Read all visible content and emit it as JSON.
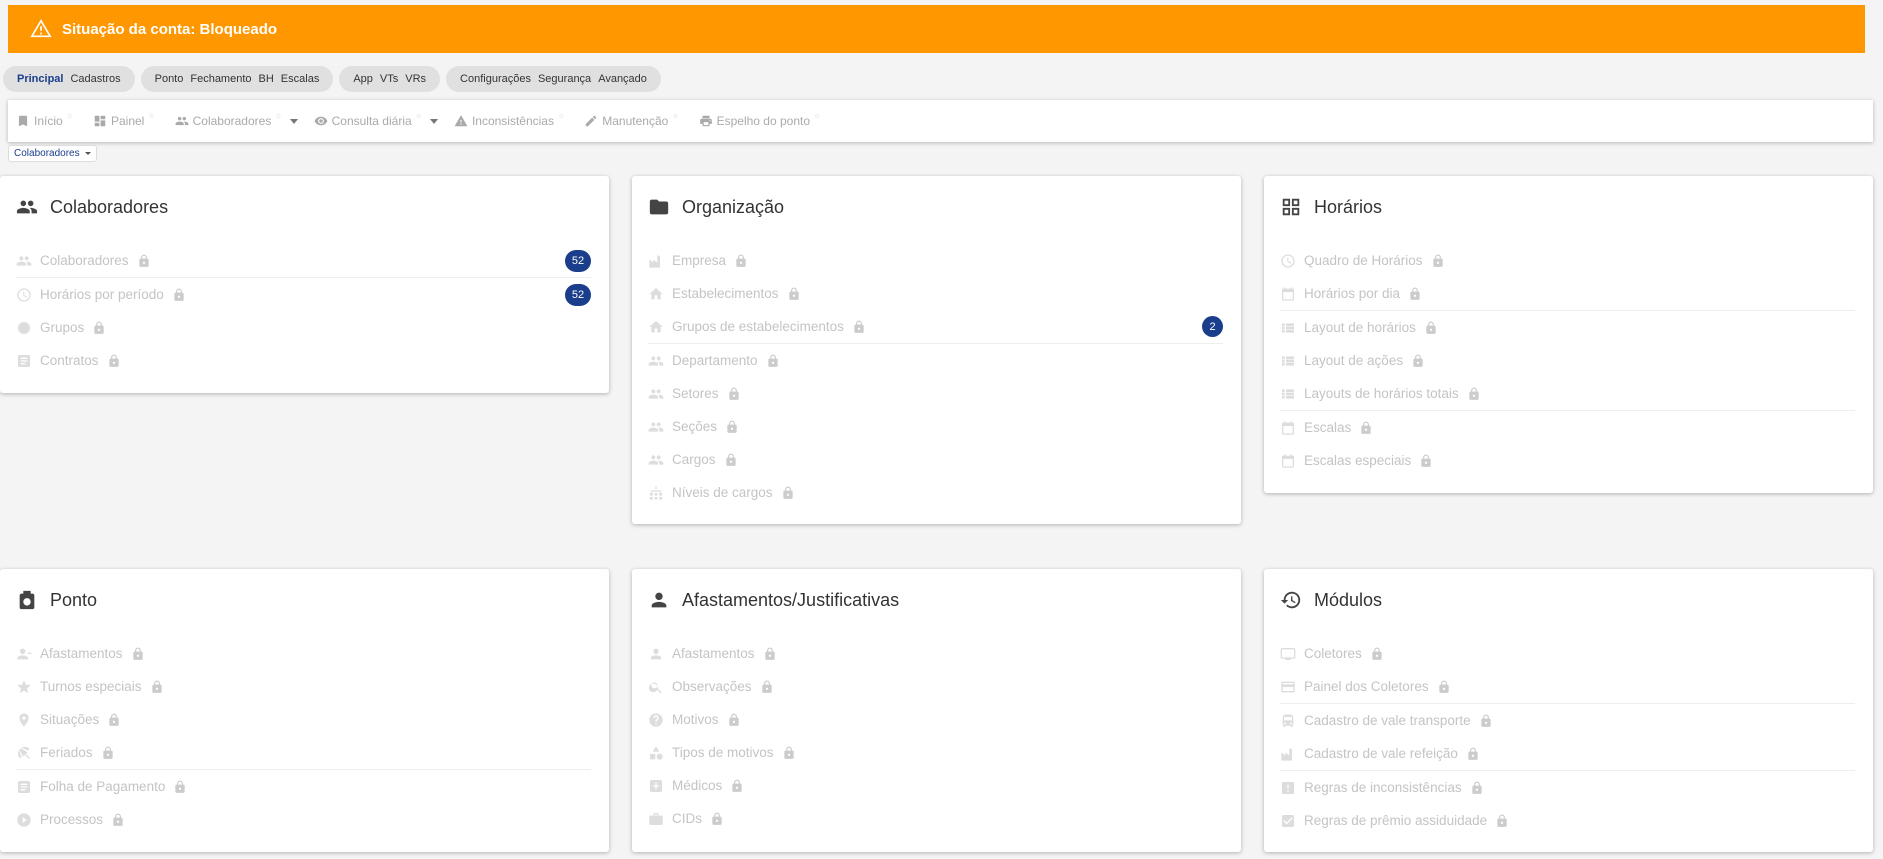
{
  "alert": {
    "text": "Situação da conta: Bloqueado",
    "color": "#ff9800"
  },
  "groups": [
    {
      "items": [
        "Principal",
        "Cadastros"
      ],
      "active": 0
    },
    {
      "items": [
        "Ponto",
        "Fechamento",
        "BH",
        "Escalas"
      ]
    },
    {
      "items": [
        "App",
        "VTs",
        "VRs"
      ]
    },
    {
      "items": [
        "Configurações",
        "Segurança",
        "Avançado"
      ]
    }
  ],
  "nav": [
    {
      "label": "Início",
      "icon": "bookmark-icon"
    },
    {
      "label": "Painel",
      "icon": "dashboard-icon"
    },
    {
      "label": "Colaboradores",
      "icon": "people-icon",
      "dropdown": true
    },
    {
      "label": "Consulta diária",
      "icon": "eye-icon",
      "dropdown": true
    },
    {
      "label": "Inconsistências",
      "icon": "warning-icon"
    },
    {
      "label": "Manutenção",
      "icon": "pencil-icon"
    },
    {
      "label": "Espelho do ponto",
      "icon": "printer-icon"
    }
  ],
  "chip": {
    "label": "Colaboradores"
  },
  "cards": {
    "colaboradores": {
      "title": "Colaboradores",
      "items": [
        {
          "label": "Colaboradores",
          "badge": "52"
        },
        {
          "label": "Horários por período",
          "badge": "52"
        },
        {
          "label": "Grupos"
        },
        {
          "label": "Contratos"
        }
      ]
    },
    "organizacao": {
      "title": "Organização",
      "items": [
        {
          "label": "Empresa"
        },
        {
          "label": "Estabelecimentos"
        },
        {
          "label": "Grupos de estabelecimentos",
          "badge": "2"
        },
        {
          "label": "Departamento"
        },
        {
          "label": "Setores"
        },
        {
          "label": "Seções"
        },
        {
          "label": "Cargos"
        },
        {
          "label": "Níveis de cargos"
        }
      ]
    },
    "horarios": {
      "title": "Horários",
      "items": [
        {
          "label": "Quadro de Horários"
        },
        {
          "label": "Horários por dia"
        },
        {
          "label": "Layout de horários"
        },
        {
          "label": "Layout de ações"
        },
        {
          "label": "Layouts de horários totais"
        },
        {
          "label": "Escalas"
        },
        {
          "label": "Escalas especiais"
        }
      ]
    },
    "ponto": {
      "title": "Ponto",
      "items": [
        {
          "label": "Afastamentos"
        },
        {
          "label": "Turnos especiais"
        },
        {
          "label": "Situações"
        },
        {
          "label": "Feriados"
        },
        {
          "label": "Folha de Pagamento"
        },
        {
          "label": "Processos"
        }
      ]
    },
    "afastamentos": {
      "title": "Afastamentos/Justificativas",
      "items": [
        {
          "label": "Afastamentos"
        },
        {
          "label": "Observações"
        },
        {
          "label": "Motivos"
        },
        {
          "label": "Tipos de motivos"
        },
        {
          "label": "Médicos"
        },
        {
          "label": "CIDs"
        }
      ]
    },
    "modulos": {
      "title": "Módulos",
      "items": [
        {
          "label": "Coletores"
        },
        {
          "label": "Painel dos Coletores"
        },
        {
          "label": "Cadastro de vale transporte"
        },
        {
          "label": "Cadastro de vale refeição"
        },
        {
          "label": "Regras de inconsistências"
        },
        {
          "label": "Regras de prêmio assiduidade"
        }
      ]
    }
  }
}
